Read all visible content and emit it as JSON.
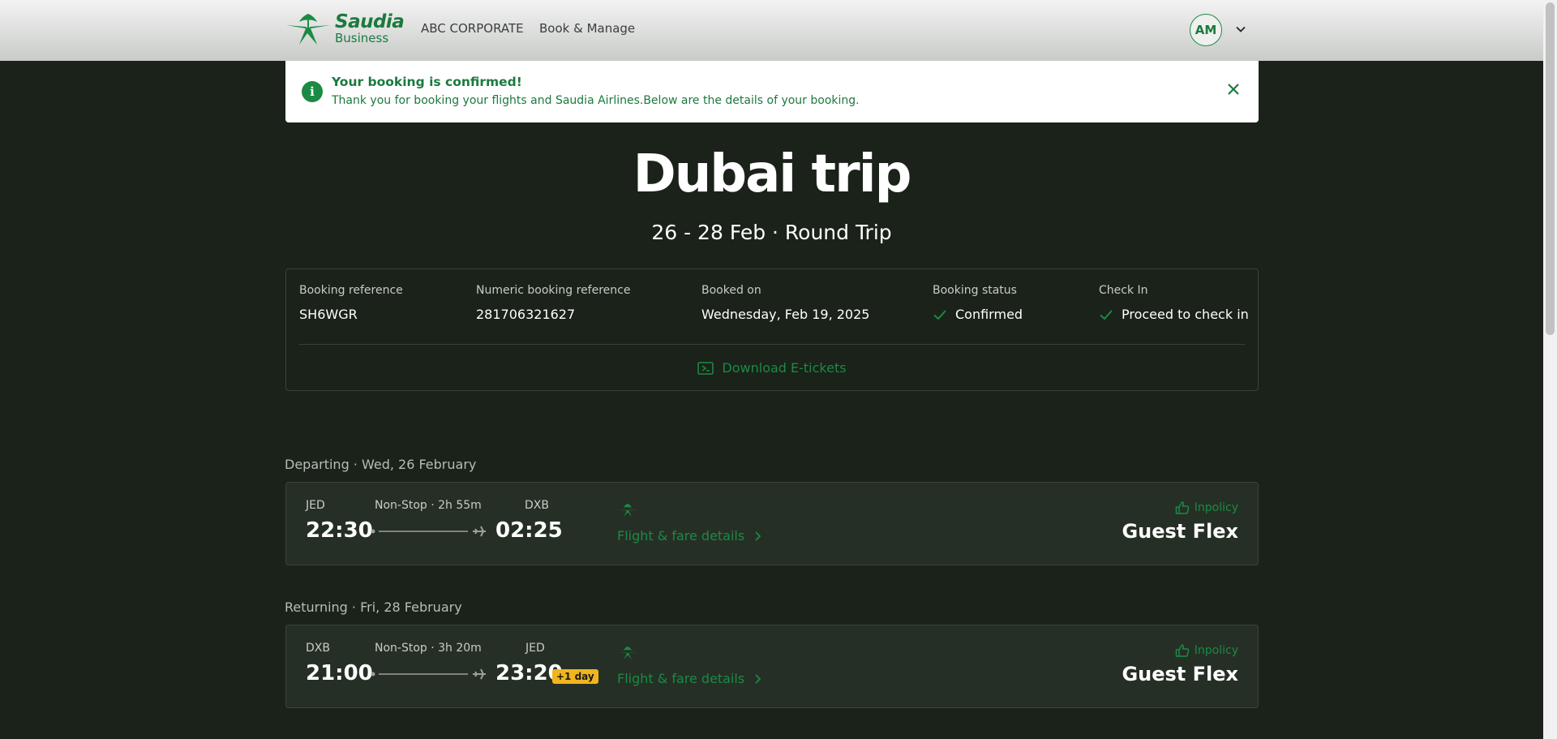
{
  "header": {
    "brand_name": "Saudia",
    "brand_sub": "Business",
    "nav": [
      "ABC CORPORATE",
      "Book & Manage"
    ],
    "avatar_initials": "AM"
  },
  "banner": {
    "title": "Your booking is confirmed!",
    "text": "Thank you for booking your flights and Saudia Airlines.Below are the details of your booking."
  },
  "trip": {
    "title": "Dubai trip",
    "subtitle": "26 - 28 Feb · Round Trip"
  },
  "booking": {
    "fields": [
      {
        "label": "Booking reference",
        "value": "SH6WGR"
      },
      {
        "label": "Numeric booking reference",
        "value": "281706321627"
      },
      {
        "label": "Booked on",
        "value": "Wednesday, Feb 19, 2025"
      },
      {
        "label": "Booking status",
        "value": "Confirmed"
      },
      {
        "label": "Check In",
        "value": "Proceed to check in"
      }
    ],
    "download_label": "Download E-tickets"
  },
  "departing": {
    "label": "Departing · Wed, 26 February",
    "from": "JED",
    "to": "DXB",
    "duration": "Non-Stop · 2h 55m",
    "dep_time": "22:30",
    "arr_time": "02:25",
    "details_link": "Flight & fare details",
    "policy": "Inpolicy",
    "fare": "Guest Flex"
  },
  "returning": {
    "label": "Returning · Fri, 28 February",
    "from": "DXB",
    "to": "JED",
    "duration": "Non-Stop · 3h 20m",
    "dep_time": "21:00",
    "arr_time": "23:20",
    "day_badge": "+1 day",
    "details_link": "Flight & fare details",
    "policy": "Inpolicy",
    "fare": "Guest Flex"
  },
  "colors": {
    "background": "#1a2219",
    "accent": "#1b8a45",
    "badge": "#f0b51e"
  }
}
